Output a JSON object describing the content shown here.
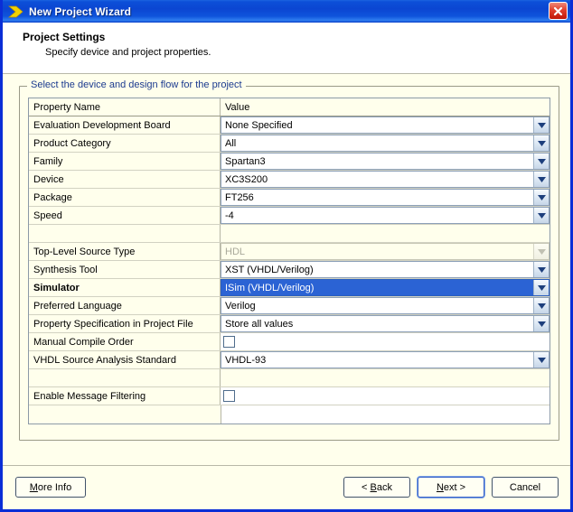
{
  "window": {
    "title": "New Project Wizard",
    "icon": "wizard-chevron-icon",
    "close_label": "×",
    "accent_color": "#0b46d2",
    "body_bg": "#ffffec"
  },
  "header": {
    "title": "Project Settings",
    "subtitle": "Specify device and project properties."
  },
  "groupbox": {
    "legend": "Select the device and design flow for the project",
    "legend_color": "#1b3a8f"
  },
  "grid": {
    "columns": [
      "Property Name",
      "Value"
    ],
    "rows": [
      {
        "name": "Evaluation Development Board",
        "value": "None Specified",
        "type": "combo",
        "state": "normal"
      },
      {
        "name": "Product Category",
        "value": "All",
        "type": "combo",
        "state": "normal"
      },
      {
        "name": "Family",
        "value": "Spartan3",
        "type": "combo",
        "state": "normal"
      },
      {
        "name": "Device",
        "value": "XC3S200",
        "type": "combo",
        "state": "normal"
      },
      {
        "name": "Package",
        "value": "FT256",
        "type": "combo",
        "state": "normal"
      },
      {
        "name": "Speed",
        "value": "-4",
        "type": "combo",
        "state": "normal"
      },
      {
        "name": "",
        "value": "",
        "type": "spacer",
        "state": "normal"
      },
      {
        "name": "Top-Level Source Type",
        "value": "HDL",
        "type": "combo",
        "state": "disabled"
      },
      {
        "name": "Synthesis Tool",
        "value": "XST (VHDL/Verilog)",
        "type": "combo",
        "state": "normal"
      },
      {
        "name": "Simulator",
        "value": "ISim (VHDL/Verilog)",
        "type": "combo",
        "state": "selected",
        "bold": true
      },
      {
        "name": "Preferred Language",
        "value": "Verilog",
        "type": "combo",
        "state": "normal"
      },
      {
        "name": "Property Specification in Project File",
        "value": "Store all values",
        "type": "combo",
        "state": "normal"
      },
      {
        "name": "Manual Compile Order",
        "value": "",
        "type": "checkbox",
        "checked": false
      },
      {
        "name": "VHDL Source Analysis Standard",
        "value": "VHDL-93",
        "type": "combo",
        "state": "normal"
      },
      {
        "name": "",
        "value": "",
        "type": "spacer",
        "state": "normal"
      },
      {
        "name": "Enable Message Filtering",
        "value": "",
        "type": "checkbox",
        "checked": false
      }
    ],
    "selection_color": "#2b63d4",
    "disabled_text_color": "#a8a89a"
  },
  "footer": {
    "buttons": [
      {
        "id": "more-info",
        "prefix": "",
        "mnemonic": "M",
        "suffix": "ore Info",
        "default": false
      },
      {
        "id": "back",
        "prefix": "< ",
        "mnemonic": "B",
        "suffix": "ack",
        "default": false
      },
      {
        "id": "next",
        "prefix": "",
        "mnemonic": "N",
        "suffix": "ext >",
        "default": true
      },
      {
        "id": "cancel",
        "prefix": "",
        "mnemonic": "",
        "suffix": "Cancel",
        "default": false
      }
    ]
  }
}
